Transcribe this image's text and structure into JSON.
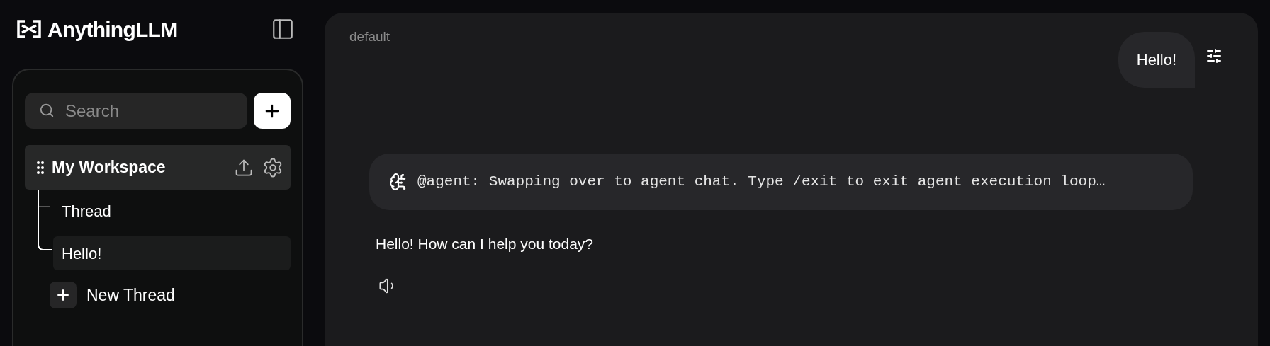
{
  "app": {
    "name": "AnythingLLM"
  },
  "sidebar": {
    "search": {
      "placeholder": "Search"
    },
    "workspaces": [
      {
        "name": "My Workspace",
        "selected": true,
        "threads": [
          {
            "name": "Thread",
            "selected": false
          },
          {
            "name": "Hello!",
            "selected": true
          }
        ]
      }
    ],
    "new_thread": "New Thread"
  },
  "chat": {
    "workspace_label": "default",
    "messages": [
      {
        "kind": "user",
        "text": "Hello!"
      },
      {
        "kind": "agent_status",
        "text": "@agent: Swapping over to agent chat. Type /exit to exit agent execution loop…"
      },
      {
        "kind": "assistant",
        "text": "Hello! How can I help you today?"
      }
    ]
  }
}
